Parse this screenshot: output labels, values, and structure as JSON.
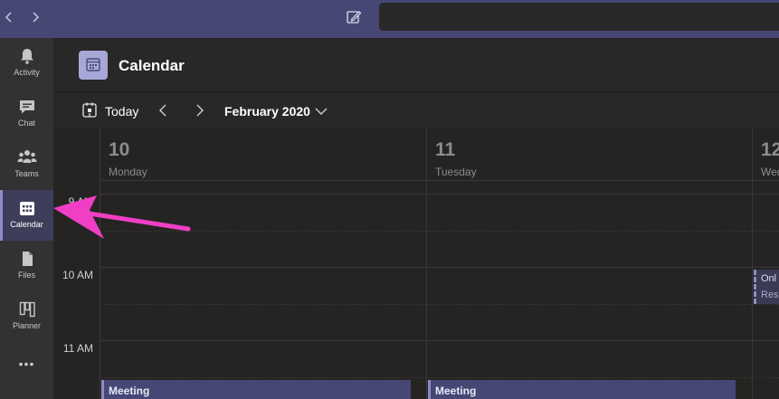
{
  "header": {
    "title": "Calendar"
  },
  "toolbar": {
    "today_label": "Today",
    "month_label": "February 2020"
  },
  "rail": {
    "items": [
      {
        "label": "Activity",
        "icon": "bell-icon"
      },
      {
        "label": "Chat",
        "icon": "chat-icon"
      },
      {
        "label": "Teams",
        "icon": "teams-icon"
      },
      {
        "label": "Calendar",
        "icon": "calendar-icon",
        "active": true
      },
      {
        "label": "Files",
        "icon": "file-icon"
      },
      {
        "label": "Planner",
        "icon": "planner-icon"
      }
    ],
    "more_label": "•••"
  },
  "days": [
    {
      "number": "10",
      "name": "Monday"
    },
    {
      "number": "11",
      "name": "Tuesday"
    },
    {
      "number": "12",
      "name": "Wed"
    }
  ],
  "times": [
    "9 AM",
    "10 AM",
    "11 AM"
  ],
  "events": [
    {
      "title": "Meeting",
      "day": "Monday"
    },
    {
      "title": "Meeting",
      "day": "Tuesday"
    }
  ],
  "peek_event": {
    "line1": "Onl",
    "line2": "Res"
  },
  "colors": {
    "accent": "#464775",
    "accent_light": "#8b8cc7",
    "annotation_arrow": "#f03fc5"
  }
}
